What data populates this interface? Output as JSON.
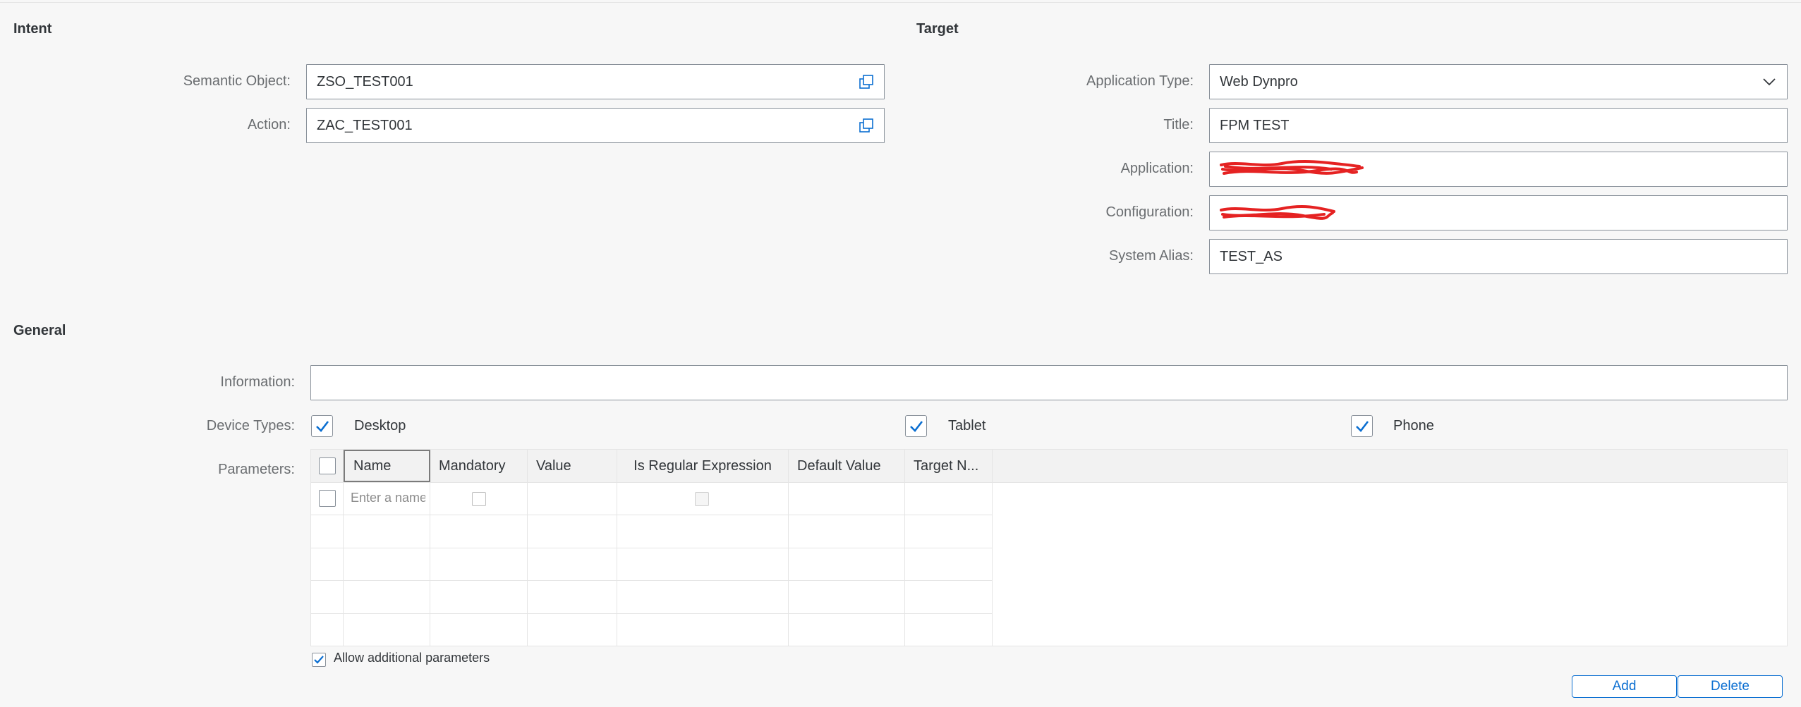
{
  "intent": {
    "title": "Intent",
    "semantic_object_label": "Semantic Object:",
    "semantic_object_value": "ZSO_TEST001",
    "action_label": "Action:",
    "action_value": "ZAC_TEST001",
    "value_help_icon": "value-help-icon"
  },
  "target": {
    "title": "Target",
    "application_type_label": "Application Type:",
    "application_type_value": "Web Dynpro",
    "title_label": "Title:",
    "title_value": "FPM TEST",
    "application_label": "Application:",
    "configuration_label": "Configuration:",
    "system_alias_label": "System Alias:",
    "system_alias_value": "TEST_AS"
  },
  "general": {
    "title": "General",
    "information_label": "Information:",
    "information_value": "",
    "device_types_label": "Device Types:",
    "device_desktop": "Desktop",
    "device_tablet": "Tablet",
    "device_phone": "Phone",
    "parameters_label": "Parameters:"
  },
  "parameters_table": {
    "columns": [
      "Name",
      "Mandatory",
      "Value",
      "Is Regular Expression",
      "Default Value",
      "Target N..."
    ],
    "name_placeholder": "Enter a name"
  },
  "allow_additional_label": "Allow additional parameters",
  "buttons": {
    "add": "Add",
    "delete": "Delete"
  },
  "colors": {
    "accent": "#0a6ed1",
    "background": "#f7f7f7",
    "redaction": "#e52222"
  }
}
